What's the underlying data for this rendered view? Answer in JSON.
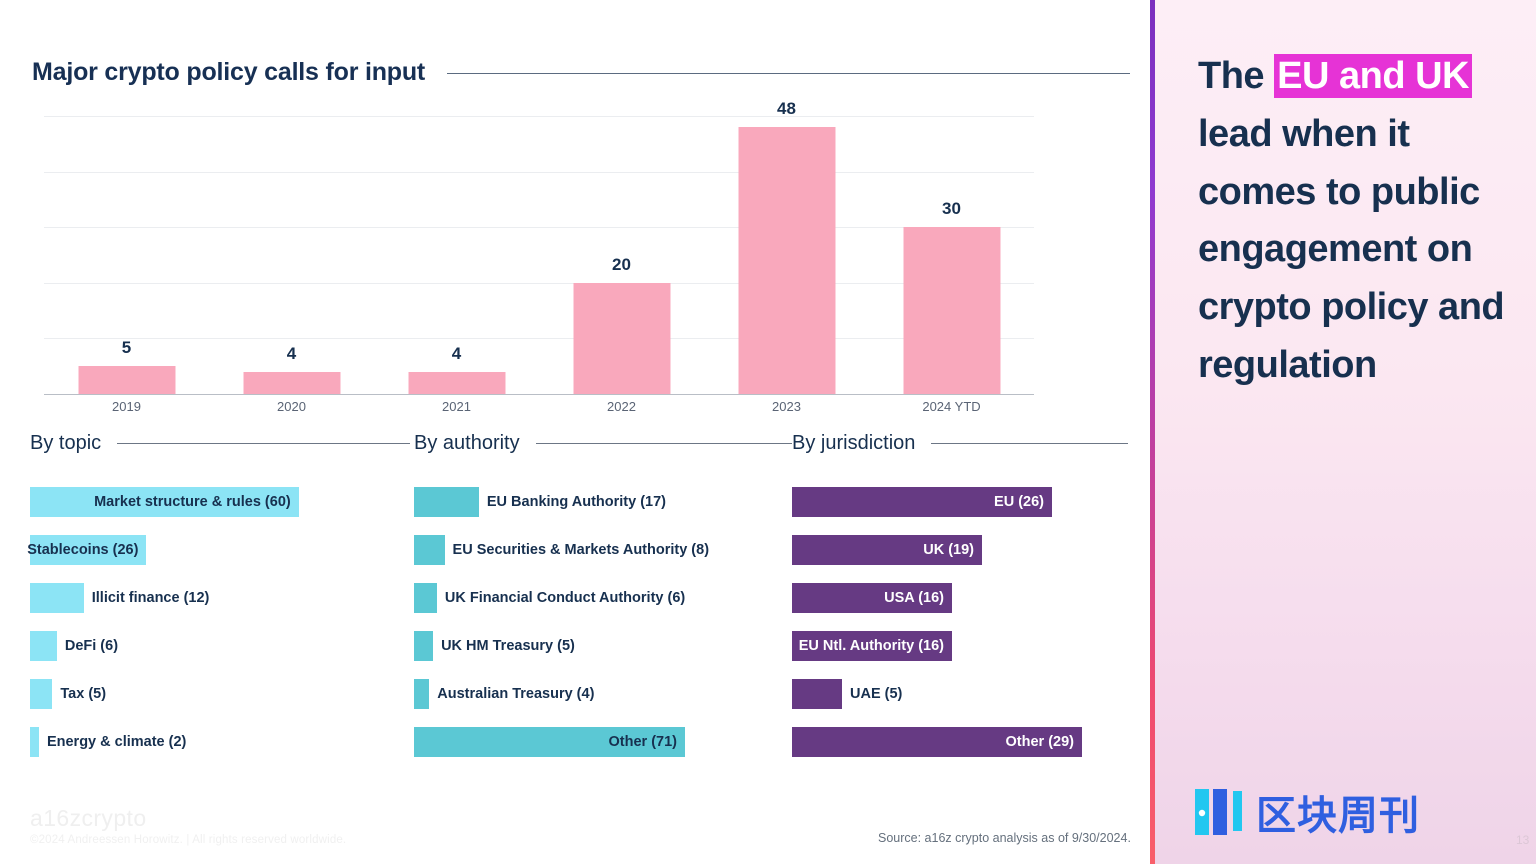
{
  "slide": {
    "title": "Major crypto policy calls for input",
    "page_number": "13",
    "colors": {
      "navy": "#17304f",
      "bar_pink": "#F9A8BC",
      "topic_cyan": "#8CE4F5",
      "authority_teal": "#5BC8D4",
      "jurisdiction_purple": "#663A83",
      "highlight_magenta": "#E633D6"
    }
  },
  "chart_data": {
    "type": "bar",
    "title": "Major crypto policy calls for input",
    "categories": [
      "2019",
      "2020",
      "2021",
      "2022",
      "2023",
      "2024 YTD"
    ],
    "values": [
      5,
      4,
      4,
      20,
      48,
      30
    ],
    "xlabel": "",
    "ylabel": "",
    "ylim": [
      0,
      50
    ],
    "gridlines": [
      10,
      20,
      30,
      40,
      50
    ],
    "grid": true,
    "legend": "none",
    "data_labels": [
      "5",
      "4",
      "4",
      "20",
      "48",
      "30"
    ]
  },
  "panels": [
    {
      "id": "topic",
      "title": "By topic",
      "max": 71,
      "bar_color": "#8CE4F5",
      "label_color": "#17304f",
      "label_position": "auto",
      "items": [
        {
          "label": "Market structure & rules (60)",
          "value": 60,
          "inside": true
        },
        {
          "label": "Stablecoins (26)",
          "value": 26,
          "inside": true
        },
        {
          "label": "Illicit finance (12)",
          "value": 12,
          "inside": false
        },
        {
          "label": "DeFi (6)",
          "value": 6,
          "inside": false
        },
        {
          "label": "Tax (5)",
          "value": 5,
          "inside": false
        },
        {
          "label": "Energy & climate (2)",
          "value": 2,
          "inside": false
        }
      ]
    },
    {
      "id": "authority",
      "title": "By authority",
      "max": 71,
      "bar_color": "#5BC8D4",
      "label_color": "#17304f",
      "label_position": "auto",
      "items": [
        {
          "label": "EU Banking Authority (17)",
          "value": 17,
          "inside": false
        },
        {
          "label": "EU Securities & Markets Authority (8)",
          "value": 8,
          "inside": false
        },
        {
          "label": "UK Financial Conduct Authority (6)",
          "value": 6,
          "inside": false
        },
        {
          "label": "UK HM Treasury (5)",
          "value": 5,
          "inside": false
        },
        {
          "label": "Australian Treasury (4)",
          "value": 4,
          "inside": false
        },
        {
          "label": "Other (71)",
          "value": 71,
          "inside": true
        }
      ]
    },
    {
      "id": "jurisdiction",
      "title": "By jurisdiction",
      "max": 29,
      "bar_color": "#663A83",
      "label_color": "#ffffff",
      "label_position": "inside",
      "items": [
        {
          "label": "EU (26)",
          "value": 26,
          "inside": true
        },
        {
          "label": "UK (19)",
          "value": 19,
          "inside": true
        },
        {
          "label": "USA (16)",
          "value": 16,
          "inside": true
        },
        {
          "label": "EU Ntl. Authority (16)",
          "value": 16,
          "inside": true
        },
        {
          "label": "UAE (5)",
          "value": 5,
          "inside": false
        },
        {
          "label": "Other (29)",
          "value": 29,
          "inside": true
        }
      ]
    }
  ],
  "footer": {
    "brand_logo": "a16zcrypto",
    "copyright": "©2024 Andreessen Horowitz.  |  All rights reserved worldwide.",
    "source": "Source: a16z crypto analysis as of 9/30/2024."
  },
  "sidebar": {
    "headline_segments": [
      {
        "text": "The ",
        "highlight": false
      },
      {
        "text": "EU and UK",
        "highlight": true
      },
      {
        "text": " lead when it comes to public engagement on crypto policy and regulation",
        "highlight": false
      }
    ],
    "headline_plain": "The EU and UK lead when it comes to public engagement on crypto policy and regulation",
    "watermark_text": "区块周刊"
  }
}
